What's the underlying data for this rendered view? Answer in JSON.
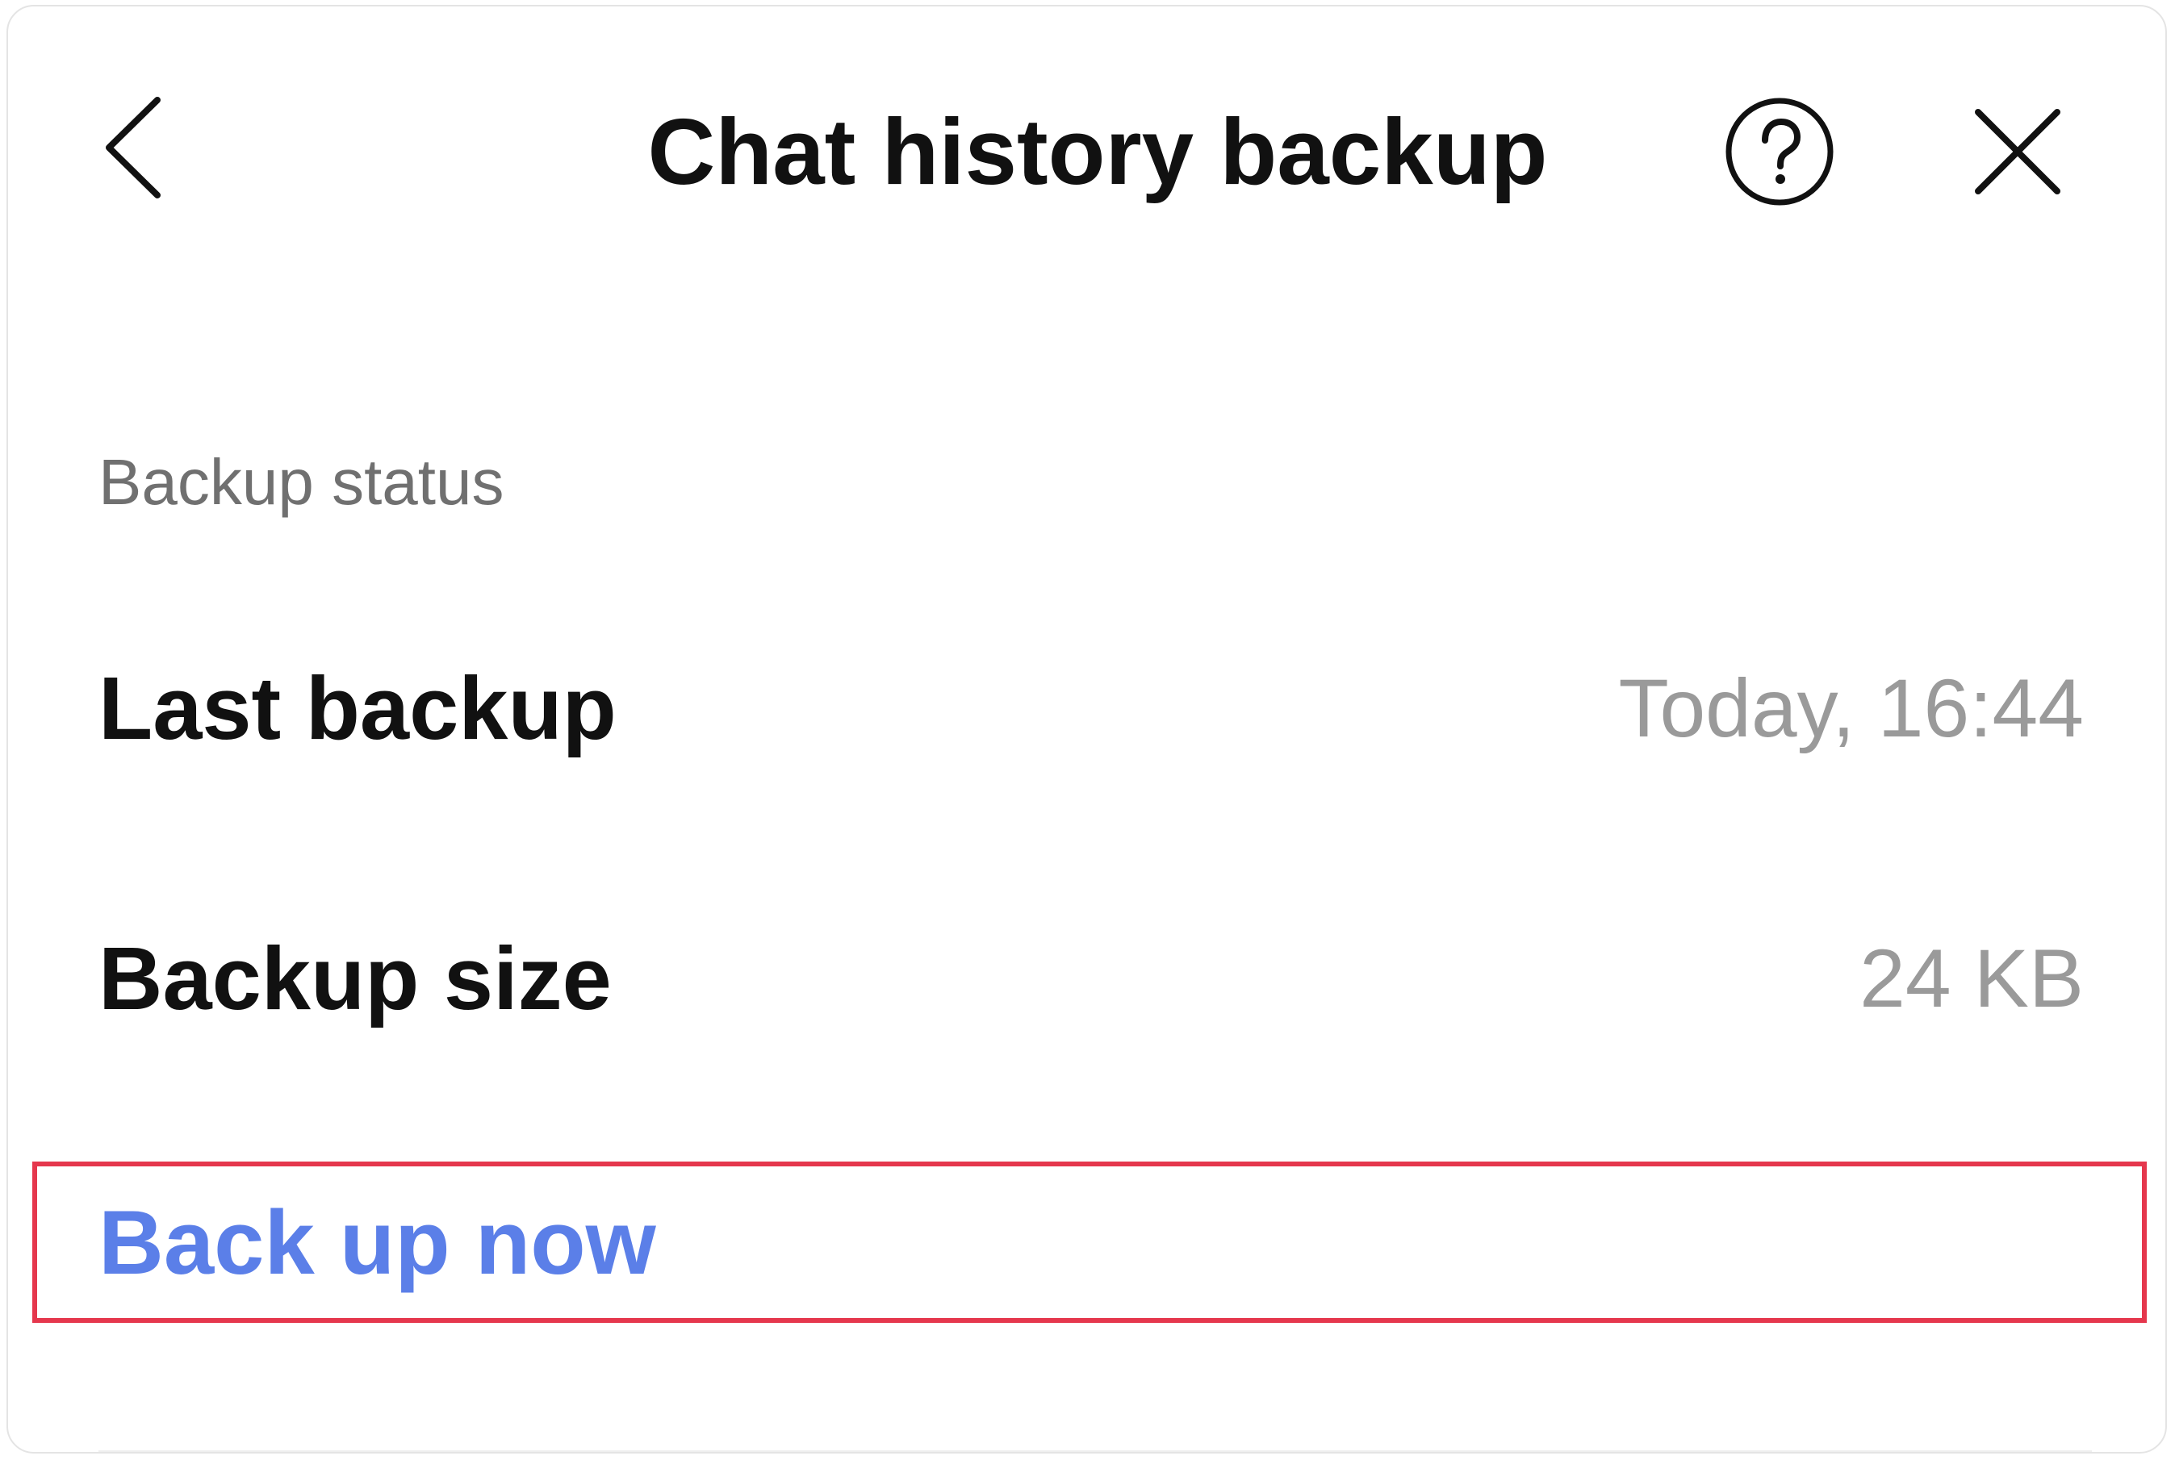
{
  "header": {
    "title": "Chat history backup",
    "back_icon": "chevron-left-icon",
    "help_icon": "help-circle-icon",
    "close_icon": "close-icon"
  },
  "backup_status": {
    "section_label": "Backup status",
    "last_backup": {
      "label": "Last backup",
      "value": "Today, 16:44"
    },
    "backup_size": {
      "label": "Backup size",
      "value": "24 KB"
    }
  },
  "actions": {
    "back_up_now_label": "Back up now"
  },
  "colors": {
    "accent": "#5b7fe8",
    "highlight_border": "#e5374d",
    "primary_text": "#111111",
    "secondary_text": "#9a9a9a"
  }
}
